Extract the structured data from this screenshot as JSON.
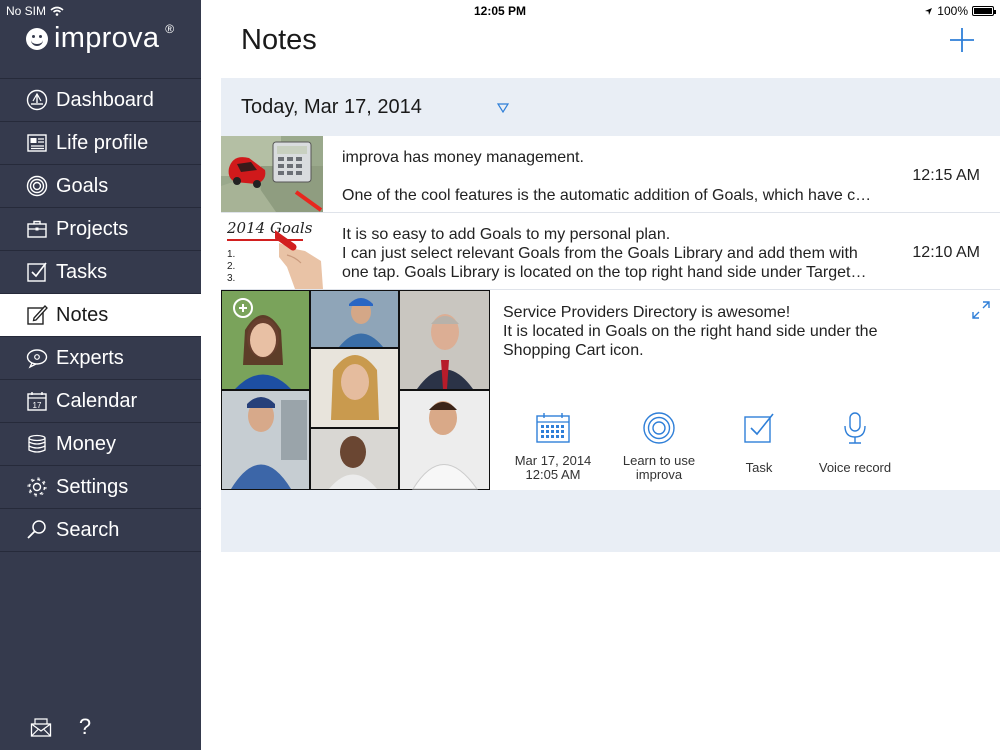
{
  "status_bar": {
    "carrier": "No SIM",
    "time": "12:05 PM",
    "battery": "100%"
  },
  "brand": {
    "name": "improva",
    "reg": "®"
  },
  "sidebar": {
    "items": [
      {
        "label": "Dashboard",
        "icon": "dashboard-icon"
      },
      {
        "label": "Life profile",
        "icon": "life-profile-icon"
      },
      {
        "label": "Goals",
        "icon": "goals-icon"
      },
      {
        "label": "Projects",
        "icon": "briefcase-icon"
      },
      {
        "label": "Tasks",
        "icon": "checkbox-icon"
      },
      {
        "label": "Notes",
        "icon": "notes-icon",
        "active": true
      },
      {
        "label": "Experts",
        "icon": "speech-bubble-icon"
      },
      {
        "label": "Calendar",
        "icon": "calendar-icon",
        "icon_text": "17"
      },
      {
        "label": "Money",
        "icon": "coins-icon"
      },
      {
        "label": "Settings",
        "icon": "gear-icon"
      },
      {
        "label": "Search",
        "icon": "search-icon"
      }
    ],
    "footer": [
      "mail-icon",
      "help-icon"
    ],
    "help_glyph": "?"
  },
  "header": {
    "title": "Notes",
    "add_icon": "plus-icon"
  },
  "date_header": {
    "label": "Today, Mar 17, 2014",
    "caret_icon": "triangle-down-icon"
  },
  "notes": [
    {
      "title": "improva has money management.",
      "body": "One of the cool features is the automatic addition of Goals, which have c…",
      "time": "12:15 AM",
      "thumb": "money-thumbnail"
    },
    {
      "title": "It is so easy to add Goals to my personal plan.",
      "body_line1": "I can just select relevant Goals from the Goals Library and add them with",
      "body_line2": "one tap. Goals Library is located on the top right hand side under Target…",
      "time": "12:10 AM",
      "thumb": "goals-list-thumbnail",
      "thumb_text": "2014 Goals",
      "thumb_list": [
        "1.",
        "2.",
        "3."
      ]
    },
    {
      "line1": "Service Providers Directory is awesome!",
      "line2": "It is located in Goals on the right hand side under the",
      "line3": "Shopping Cart icon.",
      "thumb": "people-collage",
      "actions": [
        {
          "line1": "Mar 17, 2014",
          "line2": "12:05 AM",
          "icon": "calendar-grid-icon"
        },
        {
          "line1": "Learn to use",
          "line2": "improva",
          "icon": "target-icon"
        },
        {
          "line1": "Task",
          "line2": "",
          "icon": "task-check-icon"
        },
        {
          "line1": "Voice record",
          "line2": "",
          "icon": "microphone-icon"
        }
      ]
    }
  ],
  "colors": {
    "sidebar_bg": "#353a4d",
    "accent": "#2f7fd8",
    "list_bg": "#e9eef5"
  }
}
